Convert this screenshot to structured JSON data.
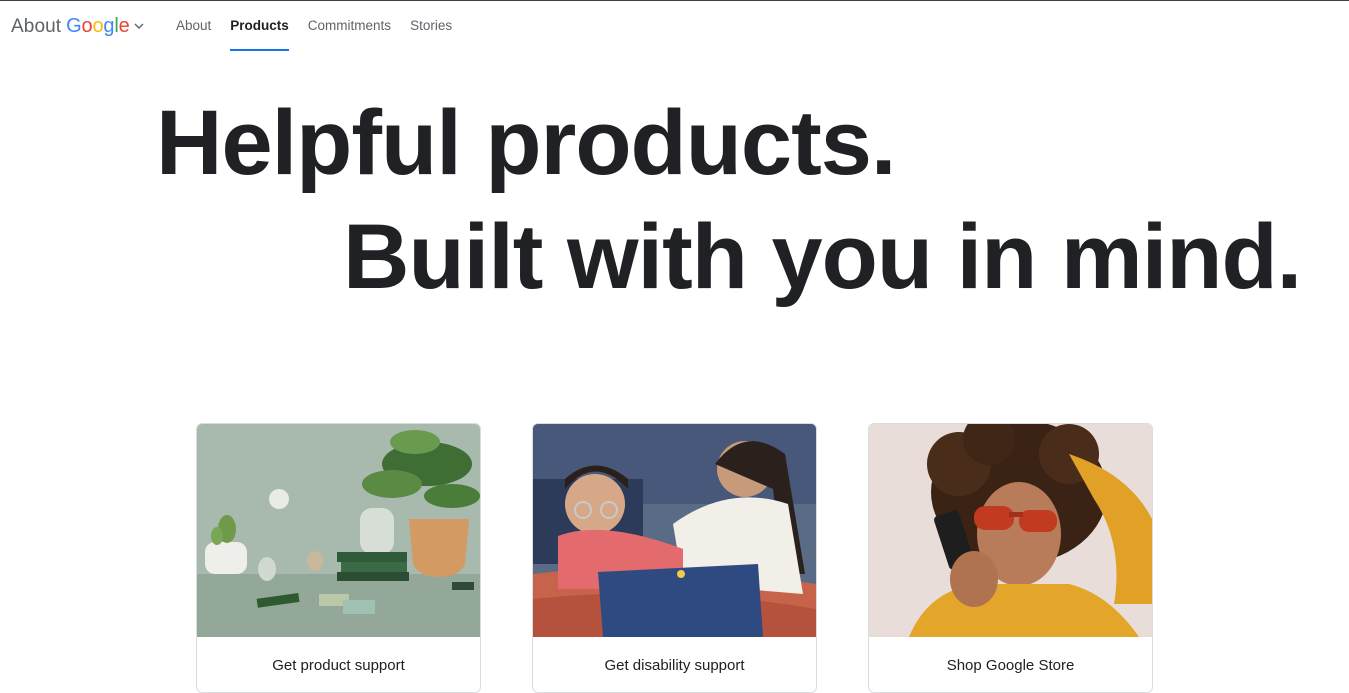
{
  "header": {
    "brand_about": "About",
    "brand_google_letters": [
      "G",
      "o",
      "o",
      "g",
      "l",
      "e"
    ],
    "nav": [
      {
        "label": "About",
        "active": false
      },
      {
        "label": "Products",
        "active": true
      },
      {
        "label": "Commitments",
        "active": false
      },
      {
        "label": "Stories",
        "active": false
      }
    ]
  },
  "hero": {
    "line1": "Helpful products.",
    "line2": "Built with you in mind."
  },
  "cards": [
    {
      "label": "Get product support",
      "image": "home-devices-plant-photo"
    },
    {
      "label": "Get disability support",
      "image": "child-and-mother-laptop-photo"
    },
    {
      "label": "Shop Google Store",
      "image": "woman-phone-sunglasses-photo"
    }
  ],
  "colors": {
    "google_blue": "#4285F4",
    "google_red": "#EA4335",
    "google_yellow": "#FBBC05",
    "google_green": "#34A853",
    "nav_underline": "#1a73e8",
    "text": "#202124"
  }
}
